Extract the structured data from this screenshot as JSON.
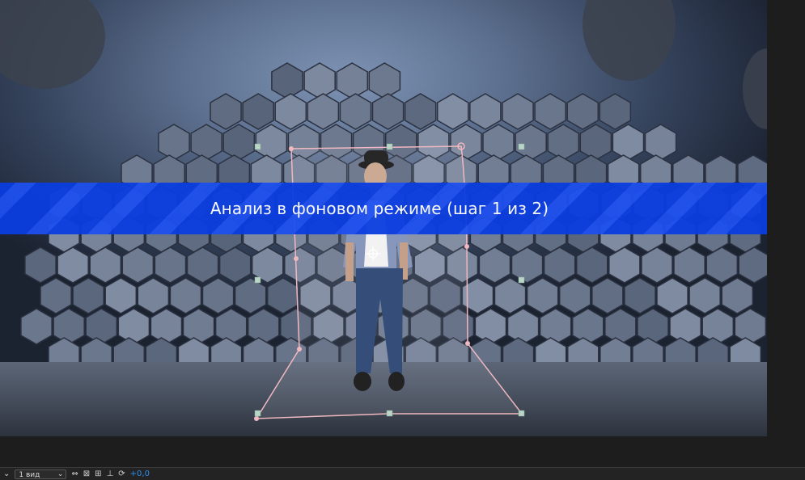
{
  "banner": {
    "text": "Анализ в фоновом режиме (шаг 1 из 2)"
  },
  "status_bar": {
    "view_select_value": "1 вид",
    "exposure_value": "+0,0",
    "icons": [
      "chevron-down-icon",
      "fit-icon",
      "snapshot-icon",
      "channels-icon",
      "grid-icon",
      "reset-exposure-icon"
    ]
  },
  "colors": {
    "banner": "#0b3de0",
    "mask_path": "#f0b8c0",
    "handle": "#b8d6c6",
    "accent": "#2d8ceb"
  }
}
